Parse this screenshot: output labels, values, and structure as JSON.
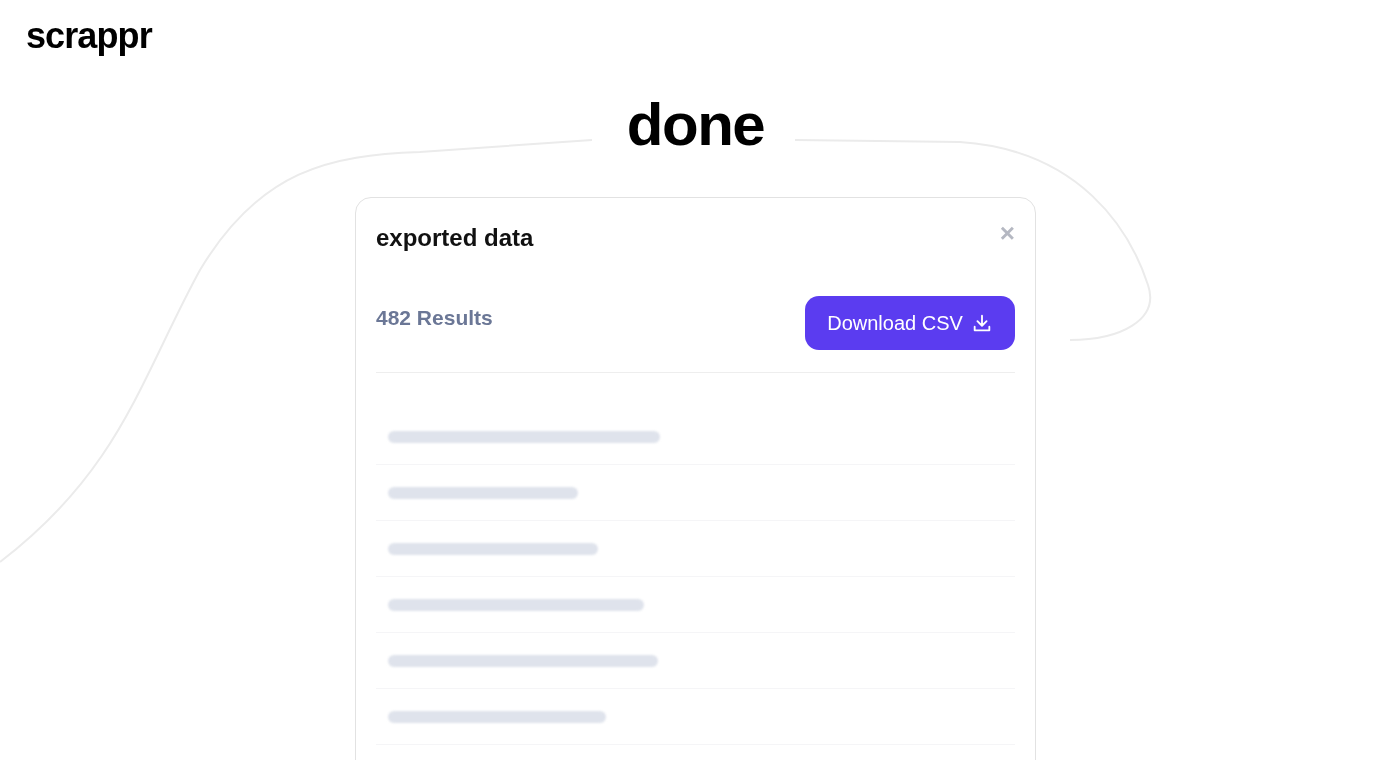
{
  "logo": "scrappr",
  "heading": "done",
  "dialog": {
    "title": "exported data",
    "close": "×",
    "results": "482 Results",
    "download_button": "Download CSV",
    "rows": [
      {
        "kind": "redacted"
      },
      {
        "kind": "redacted"
      },
      {
        "kind": "redacted"
      },
      {
        "kind": "redacted"
      },
      {
        "kind": "redacted"
      },
      {
        "kind": "redacted"
      }
    ]
  }
}
